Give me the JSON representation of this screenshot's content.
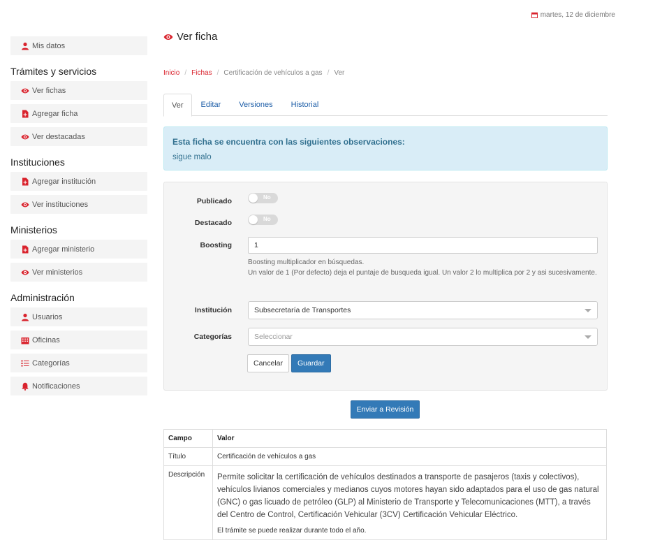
{
  "header": {
    "date": "martes, 12 de diciembre"
  },
  "sidebar": {
    "top_item": {
      "label": "Mis datos",
      "icon": "user-icon"
    },
    "sections": [
      {
        "title": "Trámites y servicios",
        "items": [
          {
            "label": "Ver fichas",
            "icon": "eye-icon"
          },
          {
            "label": "Agregar ficha",
            "icon": "file-plus-icon"
          },
          {
            "label": "Ver destacadas",
            "icon": "eye-icon"
          }
        ]
      },
      {
        "title": "Instituciones",
        "items": [
          {
            "label": "Agregar institución",
            "icon": "file-plus-icon"
          },
          {
            "label": "Ver instituciones",
            "icon": "eye-icon"
          }
        ]
      },
      {
        "title": "Ministerios",
        "items": [
          {
            "label": "Agregar ministerio",
            "icon": "file-plus-icon"
          },
          {
            "label": "Ver ministerios",
            "icon": "eye-icon"
          }
        ]
      },
      {
        "title": "Administración",
        "items": [
          {
            "label": "Usuarios",
            "icon": "user-icon"
          },
          {
            "label": "Oficinas",
            "icon": "building-icon"
          },
          {
            "label": "Categorías",
            "icon": "list-icon"
          },
          {
            "label": "Notificaciones",
            "icon": "bell-icon"
          }
        ]
      }
    ]
  },
  "page": {
    "title": "Ver ficha"
  },
  "breadcrumb": {
    "home": "Inicio",
    "fichas": "Fichas",
    "current_item": "Certificación de vehículos a gas",
    "last": "Ver",
    "separator": "/"
  },
  "tabs": [
    "Ver",
    "Editar",
    "Versiones",
    "Historial"
  ],
  "alert": {
    "title": "Esta ficha se encuentra con las siguientes observaciones:",
    "body": "sigue malo"
  },
  "form": {
    "publicado_label": "Publicado",
    "publicado_value": "No",
    "destacado_label": "Destacado",
    "destacado_value": "No",
    "boosting_label": "Boosting",
    "boosting_value": "1",
    "boosting_help1": "Boosting multiplicador en búsquedas.",
    "boosting_help2": "Un valor de 1 (Por defecto) deja el puntaje de busqueda igual. Un valor 2 lo multiplica por 2 y asi sucesivamente.",
    "institucion_label": "Institución",
    "institucion_value": "Subsecretaría de Transportes",
    "categorias_label": "Categorías",
    "categorias_placeholder": "Seleccionar",
    "cancel": "Cancelar",
    "save": "Guardar"
  },
  "send_button": "Enviar a Revisión",
  "table": {
    "headers": [
      "Campo",
      "Valor"
    ],
    "titulo_label": "Título",
    "titulo_value": "Certificación de vehículos a gas",
    "descripcion_label": "Descripción",
    "descripcion_value": "Permite solicitar la certificación de vehículos destinados a transporte de pasajeros (taxis y colectivos), vehículos livianos comerciales y medianos cuyos motores hayan sido adaptados para el uso de gas natural (GNC) o gas licuado de petróleo (GLP) al Ministerio de Transporte y Telecomunicaciones (MTT), a través del Centro de Control, Certificación Vehicular (3CV) Certificación Vehicular Eléctrico.",
    "descripcion_note": "El trámite se puede realizar durante todo el año."
  },
  "colors": {
    "accent": "#d9232d",
    "link": "#1f5fa8",
    "primary": "#337ab7",
    "alert_bg": "#d9edf7",
    "alert_text": "#31708f"
  }
}
